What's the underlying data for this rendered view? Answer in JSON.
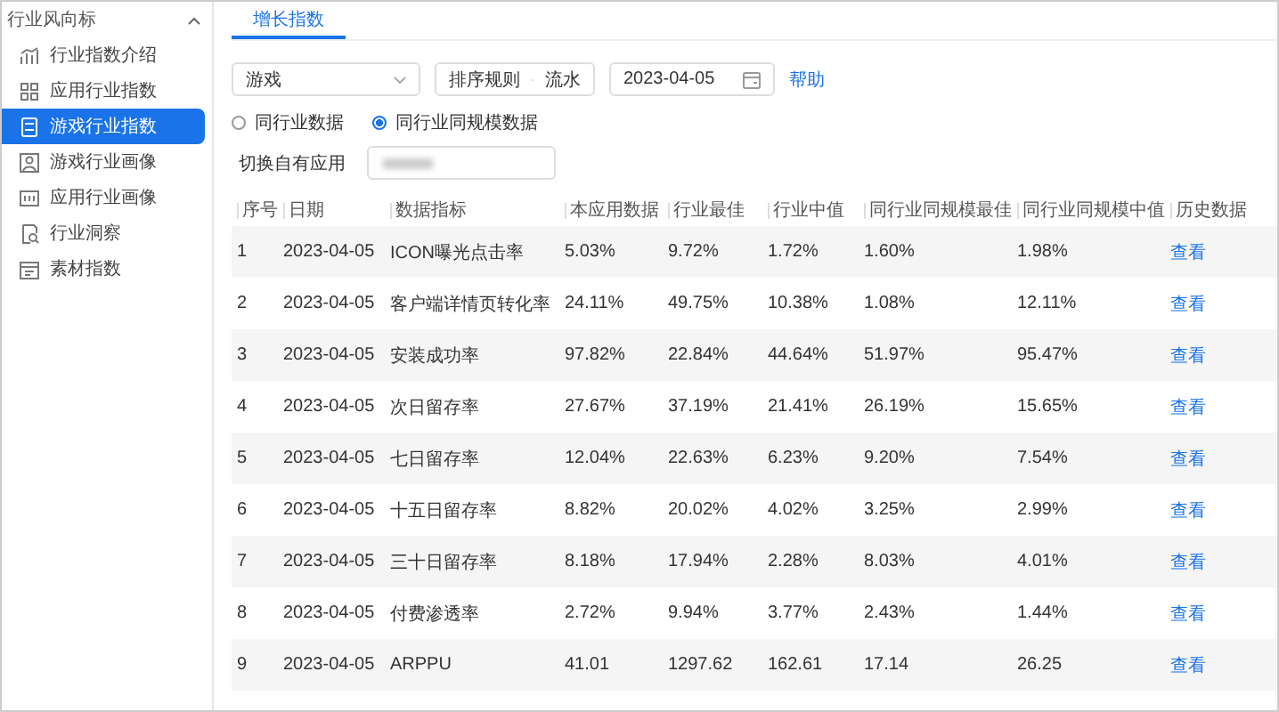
{
  "sidebar": {
    "title": "行业风向标",
    "expanded": true,
    "items": [
      {
        "label": "行业指数介绍",
        "selected": false
      },
      {
        "label": "应用行业指数",
        "selected": false
      },
      {
        "label": "游戏行业指数",
        "selected": true
      },
      {
        "label": "游戏行业画像",
        "selected": false
      },
      {
        "label": "应用行业画像",
        "selected": false
      },
      {
        "label": "行业洞察",
        "selected": false
      },
      {
        "label": "素材指数",
        "selected": false
      }
    ]
  },
  "tabs": [
    {
      "label": "增长指数",
      "selected": true
    }
  ],
  "filters": {
    "industry_select": {
      "value": "游戏"
    },
    "sort_select": {
      "label": "排序规则",
      "value": "流水"
    },
    "date_field": {
      "value": "2023-04-05"
    },
    "help_link": "帮助",
    "radios": [
      {
        "label": "同行业数据",
        "selected": false
      },
      {
        "label": "同行业同规模数据",
        "selected": true
      }
    ],
    "app_switch": {
      "label": "切换自有应用"
    }
  },
  "table": {
    "columns": [
      "序号",
      "日期",
      "数据指标",
      "本应用数据",
      "行业最佳",
      "行业中值",
      "同行业同规模最佳",
      "同行业同规模中值",
      "历史数据"
    ],
    "rows": [
      [
        "1",
        "2023-04-05",
        "ICON曝光点击率",
        "5.03%",
        "9.72%",
        "1.72%",
        "1.60%",
        "1.98%",
        "查看"
      ],
      [
        "2",
        "2023-04-05",
        "客户端详情页转化率",
        "24.11%",
        "49.75%",
        "10.38%",
        "1.08%",
        "12.11%",
        "查看"
      ],
      [
        "3",
        "2023-04-05",
        "安装成功率",
        "97.82%",
        "22.84%",
        "44.64%",
        "51.97%",
        "95.47%",
        "查看"
      ],
      [
        "4",
        "2023-04-05",
        "次日留存率",
        "27.67%",
        "37.19%",
        "21.41%",
        "26.19%",
        "15.65%",
        "查看"
      ],
      [
        "5",
        "2023-04-05",
        "七日留存率",
        "12.04%",
        "22.63%",
        "6.23%",
        "9.20%",
        "7.54%",
        "查看"
      ],
      [
        "6",
        "2023-04-05",
        "十五日留存率",
        "8.82%",
        "20.02%",
        "4.02%",
        "3.25%",
        "2.99%",
        "查看"
      ],
      [
        "7",
        "2023-04-05",
        "三十日留存率",
        "8.18%",
        "17.94%",
        "2.28%",
        "8.03%",
        "4.01%",
        "查看"
      ],
      [
        "8",
        "2023-04-05",
        "付费渗透率",
        "2.72%",
        "9.94%",
        "3.77%",
        "2.43%",
        "1.44%",
        "查看"
      ],
      [
        "9",
        "2023-04-05",
        "ARPPU",
        "41.01",
        "1297.62",
        "162.61",
        "17.14",
        "26.25",
        "查看"
      ]
    ]
  }
}
